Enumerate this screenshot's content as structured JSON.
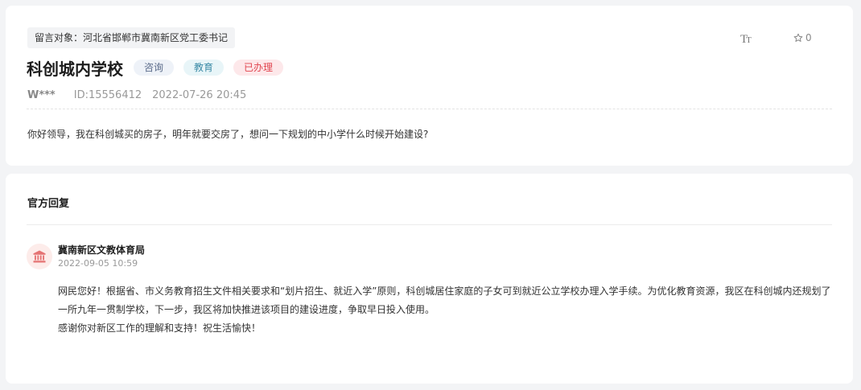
{
  "message": {
    "target_label": "留言对象：",
    "target_value": "河北省邯郸市冀南新区党工委书记",
    "title": "科创城内学校",
    "tags": [
      {
        "label": "咨询"
      },
      {
        "label": "教育"
      },
      {
        "label": "已办理"
      }
    ],
    "font_size_icon": "Tт",
    "favorite_count": "0",
    "author": "W***",
    "id_text": "ID:15556412",
    "datetime": "2022-07-26 20:45",
    "content": "你好领导，我在科创城买的房子，明年就要交房了，想问一下规划的中小学什么时候开始建设?"
  },
  "reply": {
    "heading": "官方回复",
    "org_name": "冀南新区文教体育局",
    "datetime": "2022-09-05 10:59",
    "paragraphs": [
      "网民您好！根据省、市义务教育招生文件相关要求和“划片招生、就近入学”原则，科创城居住家庭的子女可到就近公立学校办理入学手续。为优化教育资源，我区在科创城内还规划了一所九年一贯制学校，下一步，我区将加快推进该项目的建设进度，争取早日投入使用。",
      "感谢你对新区工作的理解和支持！祝生活愉快！"
    ]
  },
  "icons": {
    "font_size": "font-size-icon",
    "favorite": "star-outline-icon",
    "org": "government-building-icon"
  },
  "colors": {
    "tag_consult": "#5a6b8a",
    "tag_edu": "#3a8aa6",
    "tag_done": "#e0454f",
    "org_icon": "#e57373"
  }
}
